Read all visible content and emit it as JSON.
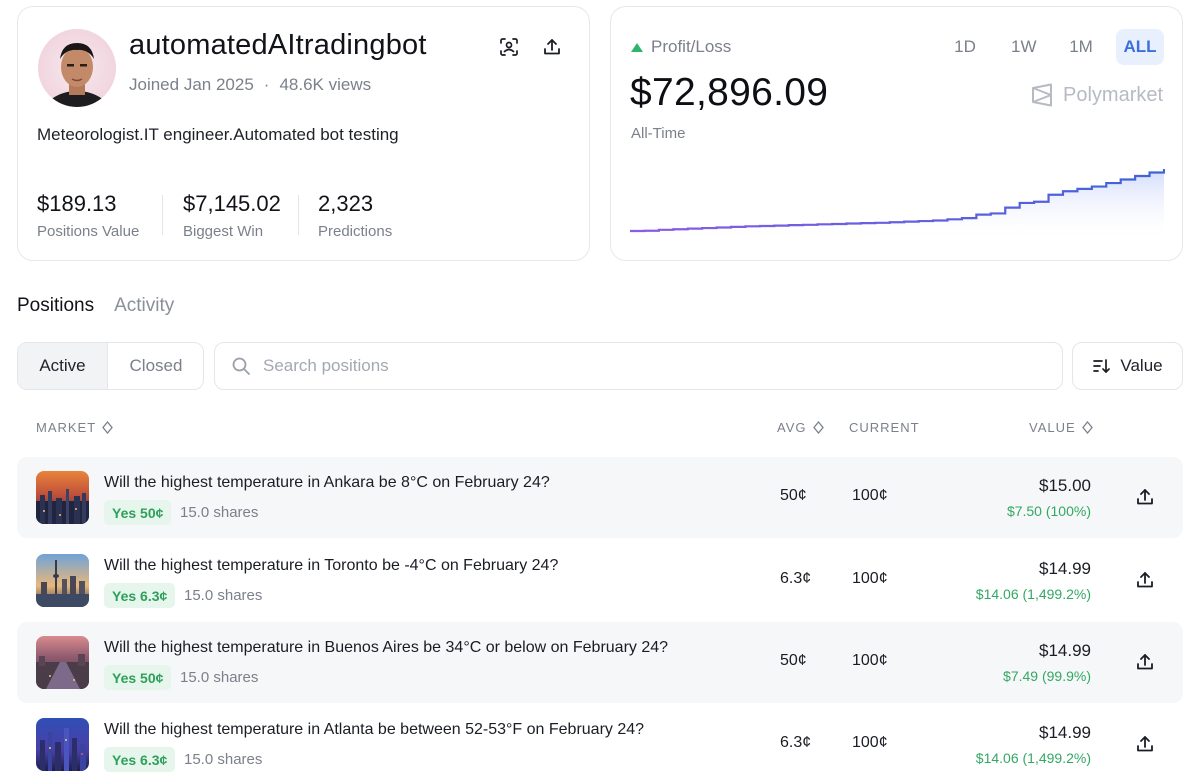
{
  "profile": {
    "username": "automatedAItradingbot",
    "joined": "Joined Jan 2025",
    "views": "48.6K views",
    "bio": "Meteorologist.IT engineer.Automated bot testing",
    "stats": [
      {
        "value": "$189.13",
        "label": "Positions Value"
      },
      {
        "value": "$7,145.02",
        "label": "Biggest Win"
      },
      {
        "value": "2,323",
        "label": "Predictions"
      }
    ]
  },
  "pnl": {
    "label": "Profit/Loss",
    "value": "$72,896.09",
    "period": "All-Time",
    "ranges": [
      "1D",
      "1W",
      "1M",
      "ALL"
    ],
    "active_range": "ALL",
    "brand": "Polymarket"
  },
  "chart_data": {
    "type": "area",
    "series": [
      {
        "values": [
          2,
          2.2,
          3,
          3.5,
          4,
          4.5,
          5,
          5.5,
          6,
          6.3,
          6.6,
          7,
          7.3,
          7.7,
          8,
          8.4,
          8.7,
          9,
          9.5,
          10,
          10.5,
          11,
          12,
          13,
          16,
          17,
          22,
          26,
          27,
          33,
          36,
          38,
          40,
          43,
          46,
          49,
          52,
          55
        ]
      }
    ],
    "gradient": [
      "#8a5ce6",
      "#3f63d8"
    ]
  },
  "tabs": {
    "positions": "Positions",
    "activity": "Activity"
  },
  "filters": {
    "active": "Active",
    "closed": "Closed"
  },
  "search": {
    "placeholder": "Search positions"
  },
  "sort": {
    "label": "Value"
  },
  "table": {
    "headers": {
      "market": "MARKET",
      "avg": "AVG",
      "current": "CURRENT",
      "value": "VALUE"
    },
    "rows": [
      {
        "question": "Will the highest temperature in Ankara be 8°C on February 24?",
        "outcome": "Yes 50¢",
        "shares": "15.0 shares",
        "avg": "50¢",
        "current": "100¢",
        "value": "$15.00",
        "pnl": "$7.50 (100%)"
      },
      {
        "question": "Will the highest temperature in Toronto be -4°C on February 24?",
        "outcome": "Yes 6.3¢",
        "shares": "15.0 shares",
        "avg": "6.3¢",
        "current": "100¢",
        "value": "$14.99",
        "pnl": "$14.06 (1,499.2%)"
      },
      {
        "question": "Will the highest temperature in Buenos Aires be 34°C or below on February 24?",
        "outcome": "Yes 50¢",
        "shares": "15.0 shares",
        "avg": "50¢",
        "current": "100¢",
        "value": "$14.99",
        "pnl": "$7.49 (99.9%)"
      },
      {
        "question": "Will the highest temperature in Atlanta be between 52-53°F on February 24?",
        "outcome": "Yes 6.3¢",
        "shares": "15.0 shares",
        "avg": "6.3¢",
        "current": "100¢",
        "value": "$14.99",
        "pnl": "$14.06 (1,499.2%)"
      }
    ]
  },
  "icons": {
    "scan": "scan-face-icon",
    "share": "share-icon",
    "profit_up": "triangle-up-icon",
    "brand": "polymarket-logo-icon",
    "search": "search-icon",
    "sort": "sort-icon",
    "sortable": "sort-diamond-icon"
  }
}
